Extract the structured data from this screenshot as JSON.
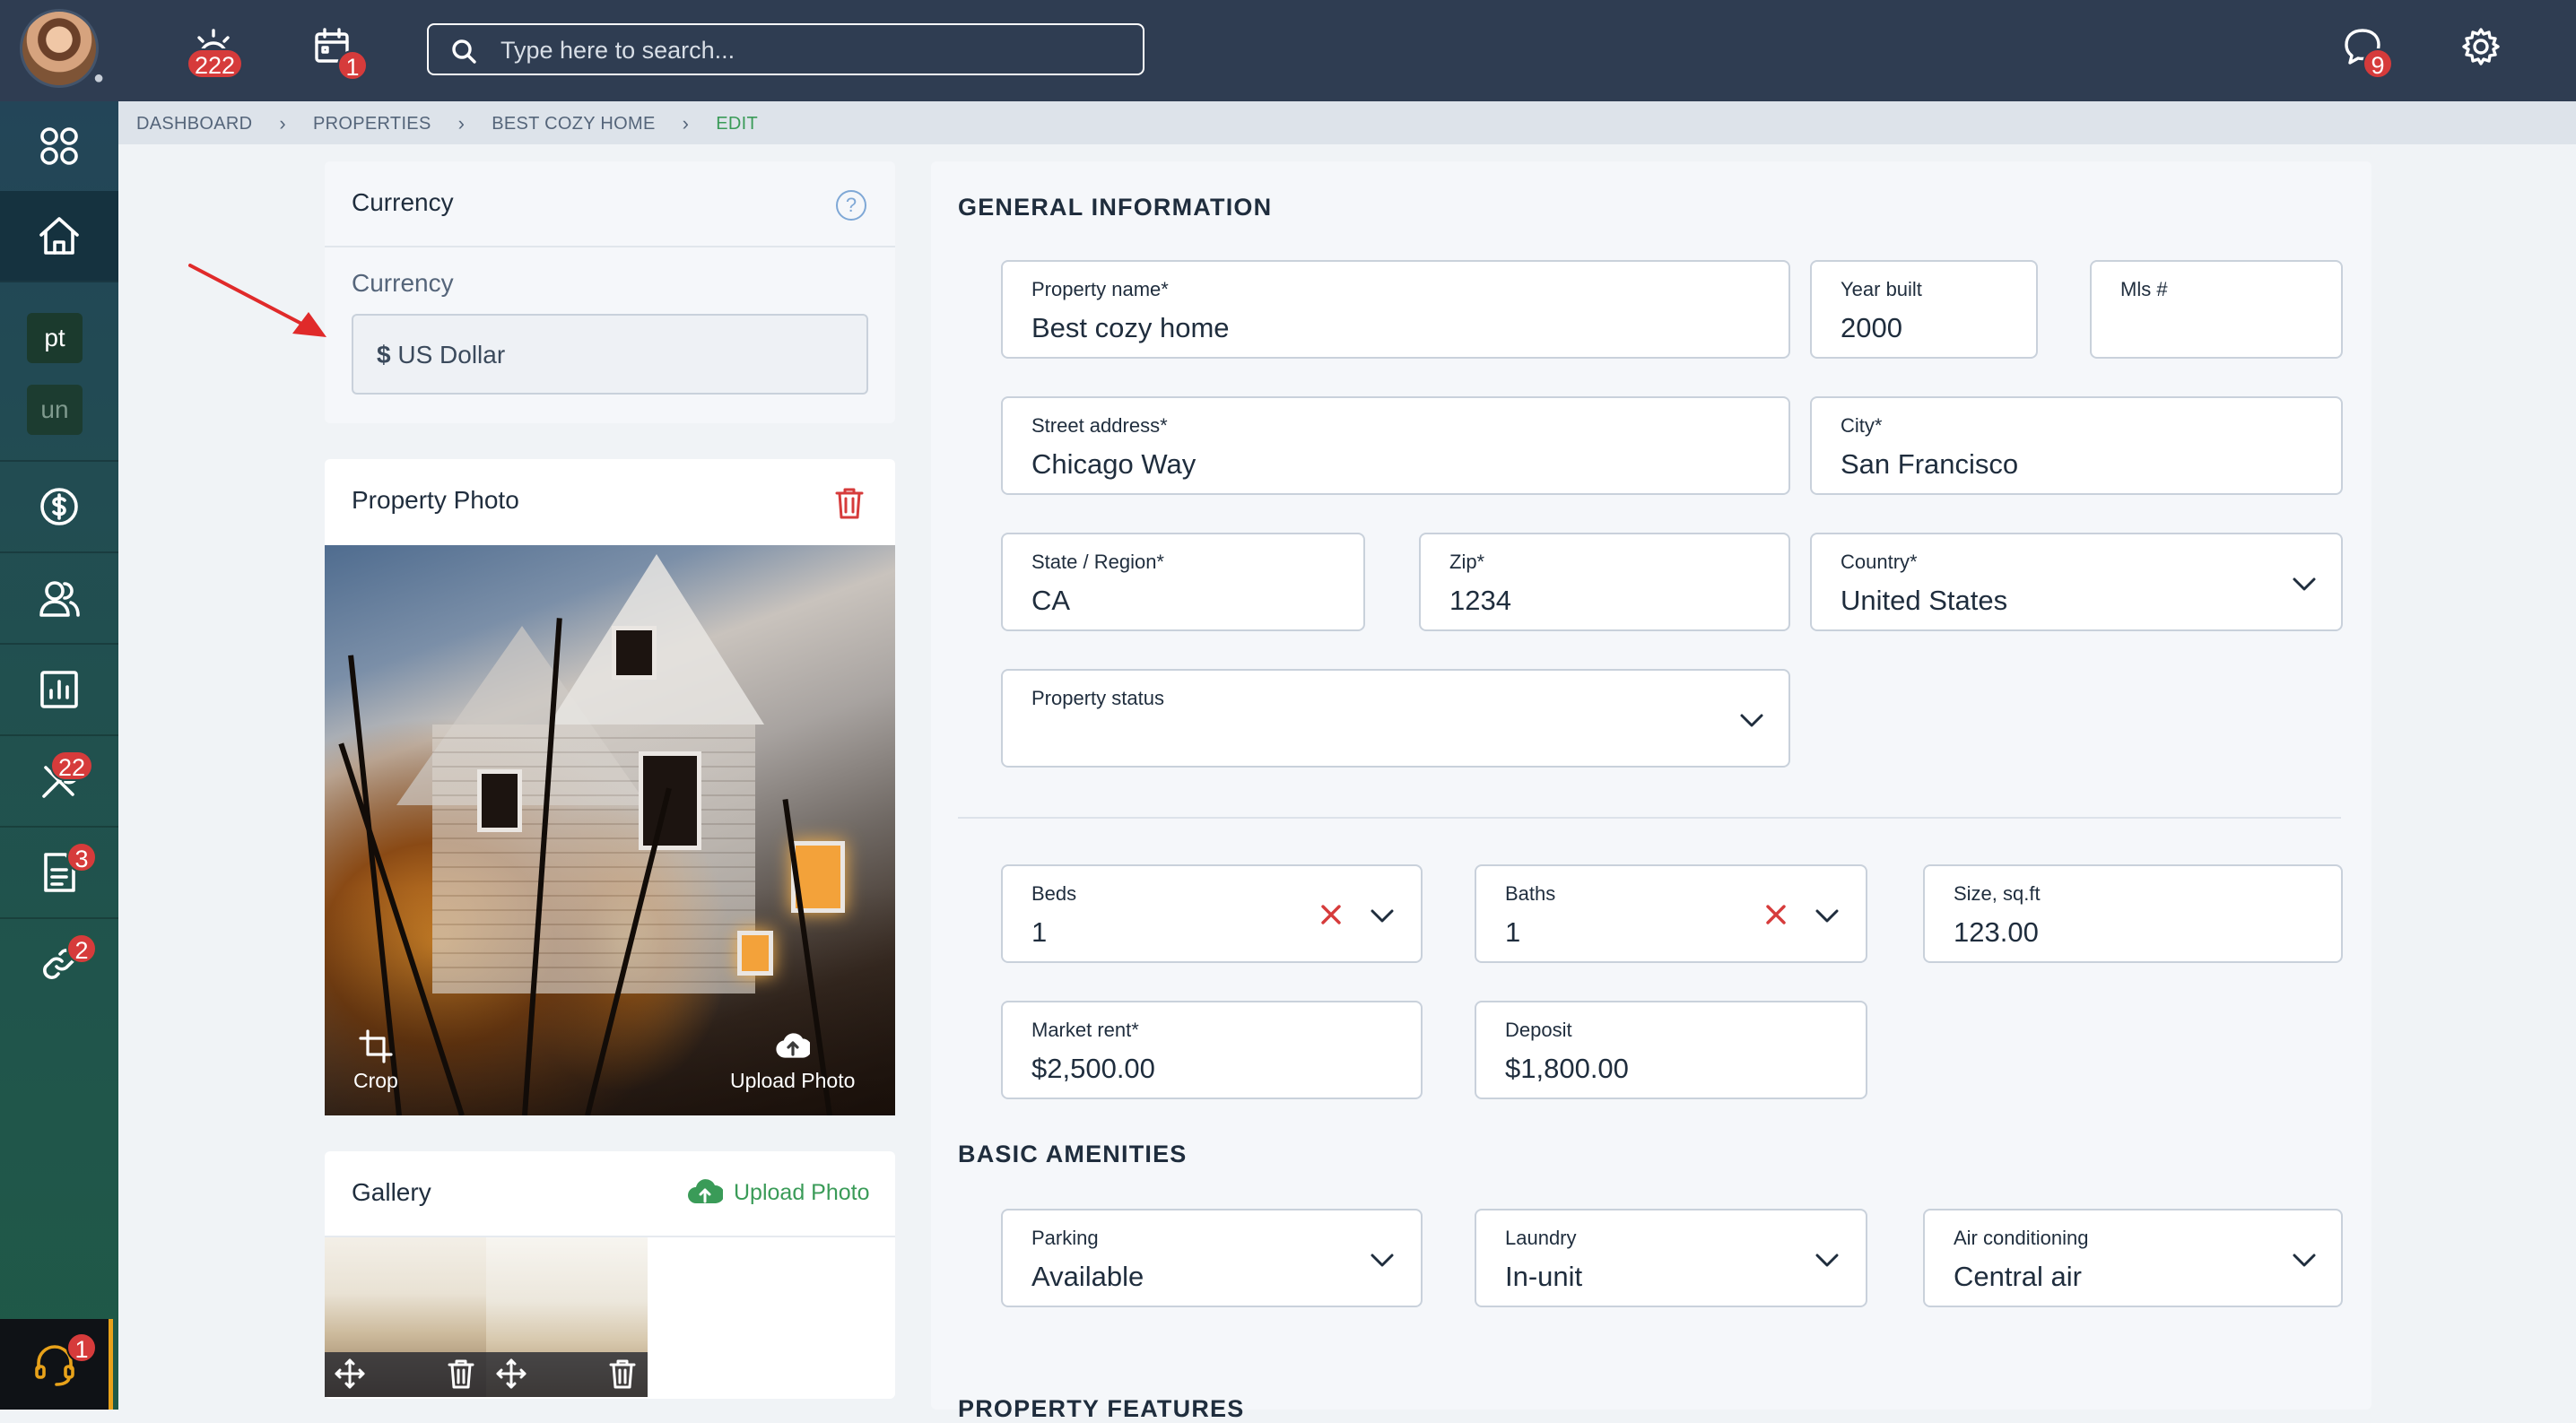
{
  "topbar": {
    "alerts_count": "222",
    "calendar_count": "1",
    "messages_count": "9",
    "search_placeholder": "Type here to search..."
  },
  "sidebar": {
    "chips": [
      "pt",
      "un"
    ],
    "maintenance_count": "22",
    "documents_count": "3",
    "links_count": "2",
    "support_count": "1"
  },
  "breadcrumb": [
    "DASHBOARD",
    "PROPERTIES",
    "BEST COZY HOME",
    "EDIT"
  ],
  "currency_card": {
    "title": "Currency",
    "help": "?",
    "field_label": "Currency",
    "symbol": "$",
    "value": "US Dollar"
  },
  "photo_card": {
    "title": "Property Photo",
    "crop_label": "Crop",
    "upload_label": "Upload Photo"
  },
  "gallery_card": {
    "title": "Gallery",
    "upload_label": "Upload Photo"
  },
  "general": {
    "title": "GENERAL INFORMATION",
    "property_name": {
      "label": "Property name*",
      "value": "Best cozy home"
    },
    "year_built": {
      "label": "Year built",
      "value": "2000"
    },
    "mls": {
      "label": "Mls #",
      "value": ""
    },
    "street": {
      "label": "Street address*",
      "value": "Chicago Way"
    },
    "city": {
      "label": "City*",
      "value": "San Francisco"
    },
    "state": {
      "label": "State / Region*",
      "value": "CA"
    },
    "zip": {
      "label": "Zip*",
      "value": "1234"
    },
    "country": {
      "label": "Country*",
      "value": "United States"
    },
    "status": {
      "label": "Property status",
      "value": ""
    }
  },
  "details": {
    "beds": {
      "label": "Beds",
      "value": "1"
    },
    "baths": {
      "label": "Baths",
      "value": "1"
    },
    "size": {
      "label": "Size, sq.ft",
      "value": "123.00"
    },
    "rent": {
      "label": "Market rent*",
      "value": "$2,500.00"
    },
    "deposit": {
      "label": "Deposit",
      "value": "$1,800.00"
    }
  },
  "amenities": {
    "title": "BASIC AMENITIES",
    "parking": {
      "label": "Parking",
      "value": "Available"
    },
    "laundry": {
      "label": "Laundry",
      "value": "In-unit"
    },
    "air": {
      "label": "Air conditioning",
      "value": "Central air"
    }
  },
  "features": {
    "title": "PROPERTY FEATURES"
  },
  "colors": {
    "topbar": "#2f3d52",
    "accent_green": "#3a9b58",
    "badge_red": "#d63b3b",
    "support_orange": "#e8a21a"
  }
}
